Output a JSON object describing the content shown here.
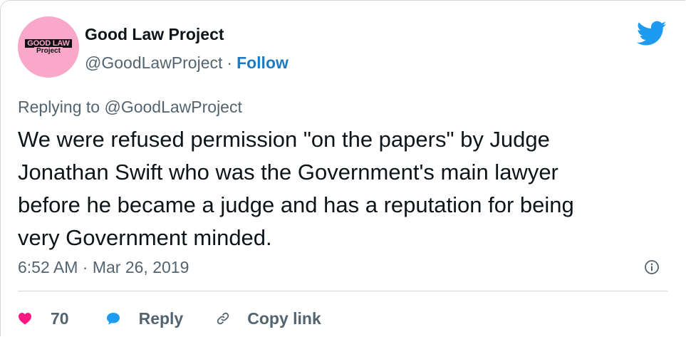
{
  "author": {
    "name": "Good Law Project",
    "handle": "@GoodLawProject",
    "separator": "·",
    "follow_label": "Follow",
    "avatar_logo_top": "GOOD LAW",
    "avatar_logo_bottom": "Project",
    "avatar_color": "#f9a8c9"
  },
  "reply_context": {
    "prefix": "Replying to",
    "handle": "@GoodLawProject"
  },
  "tweet": {
    "text": "We were refused permission \"on the papers\" by Judge\nJonathan Swift who was the Government's main lawyer\nbefore he became a judge and has a reputation for being\nvery Government minded.",
    "timestamp": "6:52 AM · Mar 26, 2019"
  },
  "actions": {
    "like_count": "70",
    "reply_label": "Reply",
    "copy_link_label": "Copy link"
  },
  "colors": {
    "brand_blue": "#1d9bf0",
    "like_red": "#f91880",
    "muted_text": "#536471"
  },
  "icons": {
    "platform": "twitter-bird-icon",
    "info": "info-icon",
    "like": "heart-icon",
    "reply": "speech-bubble-icon",
    "copy": "link-icon"
  }
}
